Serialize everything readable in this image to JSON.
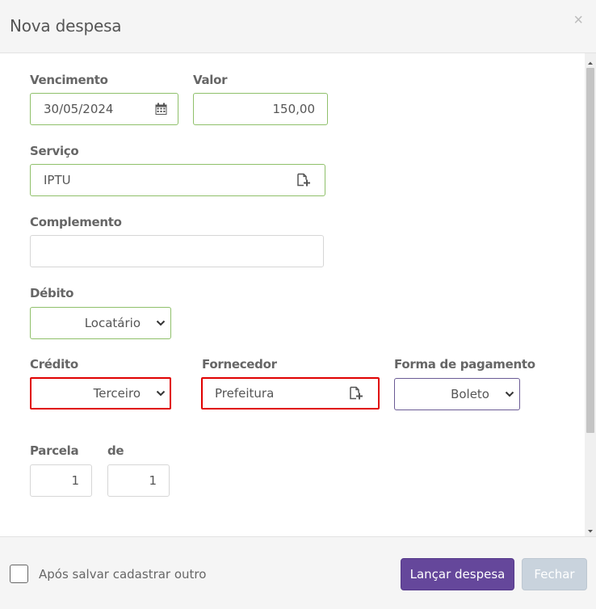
{
  "dialog": {
    "title": "Nova despesa",
    "close_label": "×"
  },
  "form": {
    "vencimento": {
      "label": "Vencimento",
      "value": "30/05/2024",
      "icon": "calendar-icon"
    },
    "valor": {
      "label": "Valor",
      "value": "150,00"
    },
    "servico": {
      "label": "Serviço",
      "value": "IPTU",
      "icon": "add-document-icon"
    },
    "complemento": {
      "label": "Complemento",
      "value": ""
    },
    "debito": {
      "label": "Débito",
      "value": "Locatário"
    },
    "credito": {
      "label": "Crédito",
      "value": "Terceiro"
    },
    "fornecedor": {
      "label": "Fornecedor",
      "value": "Prefeitura",
      "icon": "add-document-icon"
    },
    "forma_pagamento": {
      "label": "Forma de pagamento",
      "value": "Boleto"
    },
    "parcela": {
      "label": "Parcela",
      "value": "1"
    },
    "de": {
      "label": "de",
      "value": "1"
    }
  },
  "footer": {
    "checkbox_label": "Após salvar cadastrar outro",
    "checkbox_checked": false,
    "primary_button": "Lançar despesa",
    "secondary_button": "Fechar"
  },
  "colors": {
    "primary": "#65479b",
    "valid_border": "#8fc06a",
    "error_border": "#e00000",
    "disabled_button": "#c9d3dd"
  }
}
